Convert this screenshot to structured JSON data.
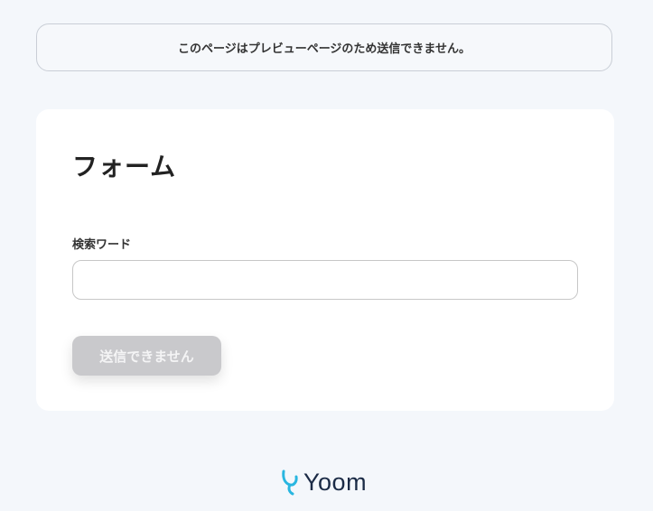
{
  "notice": {
    "text": "このページはプレビューページのため送信できません。"
  },
  "form": {
    "title": "フォーム",
    "fields": [
      {
        "label": "検索ワード",
        "value": "",
        "placeholder": ""
      }
    ],
    "submit_label": "送信できません"
  },
  "footer": {
    "brand": "Yoom",
    "logo_icon": "yoom-logo-icon",
    "logo_color": "#29b6e0"
  }
}
